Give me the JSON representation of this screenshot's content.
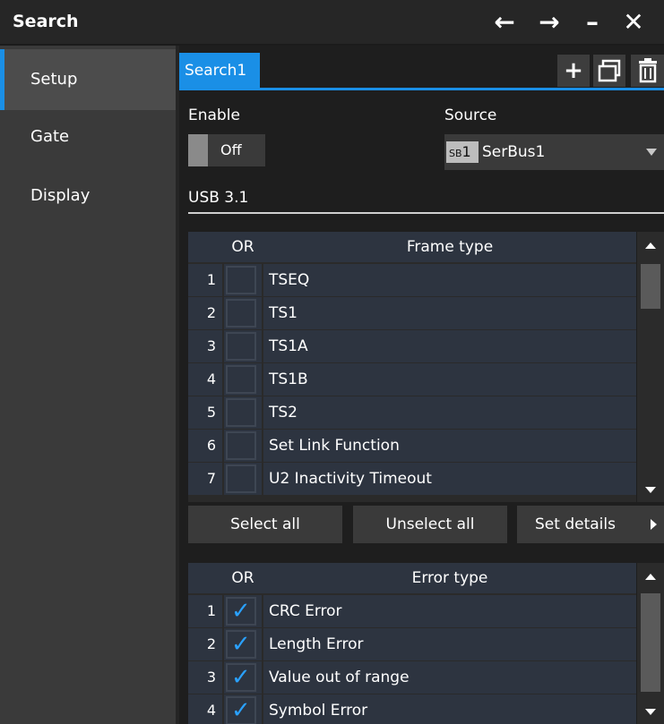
{
  "window": {
    "title": "Search",
    "icons": [
      "arrow-left-icon",
      "arrow-right-icon",
      "minimize-icon",
      "close-icon"
    ]
  },
  "sidebar": {
    "items": [
      {
        "label": "Setup",
        "active": true
      },
      {
        "label": "Gate",
        "active": false
      },
      {
        "label": "Display",
        "active": false
      }
    ]
  },
  "tabs": {
    "active": "Search1",
    "buttons": [
      "add-icon",
      "copy-icon",
      "delete-icon"
    ]
  },
  "setup": {
    "enable_label": "Enable",
    "enable_state": "Off",
    "source_label": "Source",
    "source_badge_prefix": "SB",
    "source_badge_num": "1",
    "source_value": "SerBus1",
    "protocol": "USB 3.1"
  },
  "frame_table": {
    "col_or": "OR",
    "col_type": "Frame type",
    "rows": [
      {
        "num": "1",
        "label": "TSEQ",
        "checked": false
      },
      {
        "num": "2",
        "label": "TS1",
        "checked": false
      },
      {
        "num": "3",
        "label": "TS1A",
        "checked": false
      },
      {
        "num": "4",
        "label": "TS1B",
        "checked": false
      },
      {
        "num": "5",
        "label": "TS2",
        "checked": false
      },
      {
        "num": "6",
        "label": "Set Link Function",
        "checked": false
      },
      {
        "num": "7",
        "label": "U2 Inactivity Timeout",
        "checked": false
      }
    ]
  },
  "buttons": {
    "select_all": "Select all",
    "unselect_all": "Unselect all",
    "set_details": "Set details"
  },
  "error_table": {
    "col_or": "OR",
    "col_type": "Error type",
    "rows": [
      {
        "num": "1",
        "label": "CRC Error",
        "checked": true
      },
      {
        "num": "2",
        "label": "Length Error",
        "checked": true
      },
      {
        "num": "3",
        "label": "Value out of range",
        "checked": true
      },
      {
        "num": "4",
        "label": "Symbol Error",
        "checked": true
      }
    ]
  },
  "colors": {
    "accent": "#1a8fe6",
    "check": "#2aa1ff"
  }
}
